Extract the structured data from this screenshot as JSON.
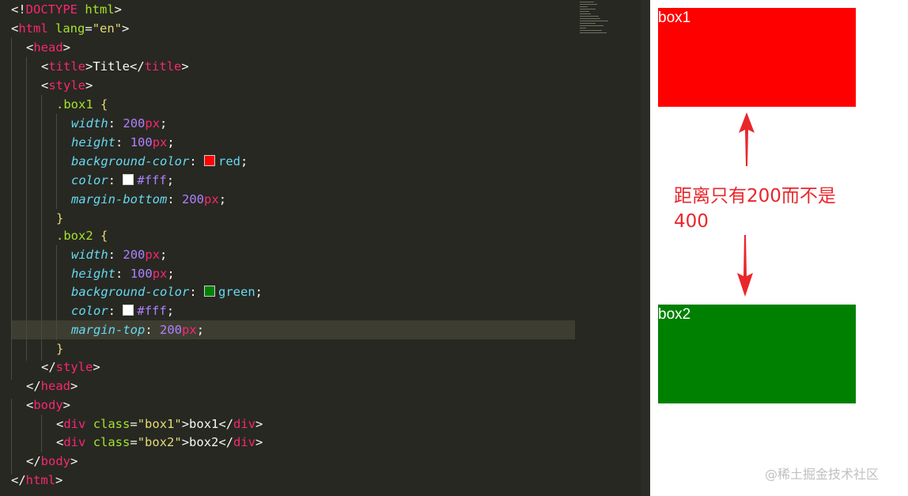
{
  "editor": {
    "lines": [
      [
        "<!DOCTYPE html>"
      ],
      [
        "<html lang=\"en\">"
      ],
      [
        "<head>"
      ],
      [
        "<title>Title</title>"
      ],
      [
        "<style>"
      ],
      [
        ".box1 {"
      ],
      [
        "width: 200px;"
      ],
      [
        "height: 100px;"
      ],
      [
        "background-color: red;"
      ],
      [
        "color: #fff;"
      ],
      [
        "margin-bottom: 200px;"
      ],
      [
        "}"
      ],
      [
        ".box2 {"
      ],
      [
        "width: 200px;"
      ],
      [
        "height: 100px;"
      ],
      [
        "background-color: green;"
      ],
      [
        "color: #fff;"
      ],
      [
        "margin-top: 200px;"
      ],
      [
        "}"
      ],
      [
        "</style>"
      ],
      [
        "</head>"
      ],
      [
        "<body>"
      ],
      [
        "<div class=\"box1\">box1</div>"
      ],
      [
        "<div class=\"box2\">box2</div>"
      ],
      [
        "</body>"
      ],
      [
        "</html>"
      ]
    ],
    "tokens": {
      "doctype_open": "<!",
      "doctype": "DOCTYPE",
      "html_kw": "html",
      "lt": "<",
      "gt": ">",
      "lt_slash": "</",
      "eq": "=",
      "html": "html",
      "lang": "lang",
      "lang_val": "\"en\"",
      "head": "head",
      "title": "title",
      "title_text": "Title",
      "style": "style",
      "body": "body",
      "div": "div",
      "class": "class",
      "box1_class": "\"box1\"",
      "box2_class": "\"box2\"",
      "box1_text": "box1",
      "box2_text": "box2",
      "sel_box1": ".box1",
      "sel_box2": ".box2",
      "brace_open": "{",
      "brace_close": "}",
      "colon": ":",
      "semi": ";",
      "width": "width",
      "height": "height",
      "bg_color": "background-color",
      "color": "color",
      "margin_bottom": "margin-bottom",
      "margin_top": "margin-top",
      "n200": "200",
      "n100": "100",
      "px": "px",
      "red": "red",
      "green": "green",
      "hex_fff": "#fff"
    },
    "colors": {
      "background": "#272822",
      "highlight_line": "#3e3d32",
      "tag": "#f92672",
      "attribute": "#a6e22e",
      "string": "#e6db74",
      "property": "#66d9ef",
      "number": "#ae81ff"
    },
    "swatches": {
      "red": "#ff0000",
      "white": "#ffffff",
      "green": "#008000"
    }
  },
  "preview": {
    "box1_label": "box1",
    "box2_label": "box2",
    "box1_color": "#ff0000",
    "box2_color": "#008000",
    "annotation_line1": "距离只有200而不是",
    "annotation_line2": "400",
    "annotation_color": "#e8272b",
    "watermark": "@稀土掘金技术社区"
  }
}
